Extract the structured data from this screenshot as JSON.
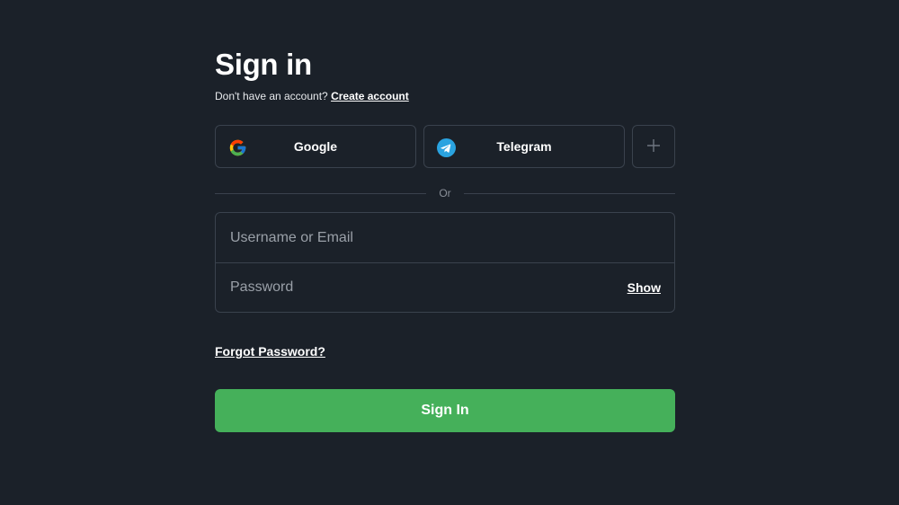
{
  "title": "Sign in",
  "signup_prompt": {
    "text": "Don't have an account?",
    "link_label": "Create account"
  },
  "social": {
    "google_label": "Google",
    "telegram_label": "Telegram",
    "more_label": "+"
  },
  "divider_label": "Or",
  "form": {
    "username_placeholder": "Username or Email",
    "password_placeholder": "Password",
    "show_label": "Show"
  },
  "forgot_label": "Forgot Password?",
  "submit_label": "Sign In",
  "colors": {
    "background": "#1b2129",
    "border": "#3a424d",
    "accent": "#45b05a",
    "telegram": "#2aa3e0"
  },
  "icons": {
    "google": "google-icon",
    "telegram": "telegram-icon",
    "more": "plus-icon"
  }
}
